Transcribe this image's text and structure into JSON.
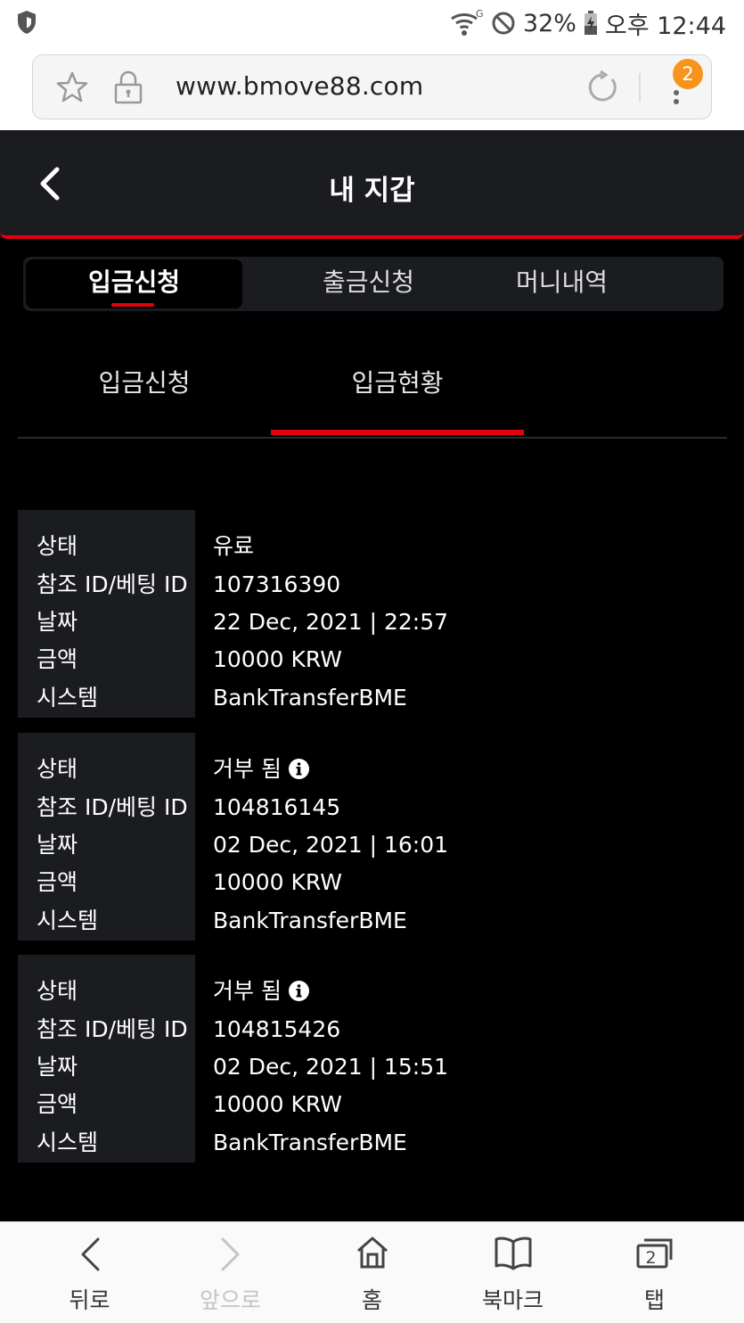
{
  "status_bar": {
    "battery": "32%",
    "time": "오후 12:44",
    "network_badge": "G"
  },
  "browser": {
    "url": "www.bmove88.com",
    "menu_badge": "2"
  },
  "header": {
    "title": "내 지갑"
  },
  "main_tabs": [
    {
      "label": "입금신청",
      "active": true
    },
    {
      "label": "출금신청",
      "active": false
    },
    {
      "label": "머니내역",
      "active": false
    }
  ],
  "sub_tabs": [
    {
      "label": "입금신청",
      "active": false
    },
    {
      "label": "입금현황",
      "active": true
    }
  ],
  "field_labels": {
    "status": "상태",
    "ref_id": "참조 ID/베팅 ID",
    "date": "날짜",
    "amount": "금액",
    "system": "시스템"
  },
  "records": [
    {
      "status": "유료",
      "status_info": false,
      "ref_id": "107316390",
      "date": "22 Dec, 2021 | 22:57",
      "amount": "10000 KRW",
      "system": "BankTransferBME"
    },
    {
      "status": "거부 됨",
      "status_info": true,
      "ref_id": "104816145",
      "date": "02 Dec, 2021 | 16:01",
      "amount": "10000 KRW",
      "system": "BankTransferBME"
    },
    {
      "status": "거부 됨",
      "status_info": true,
      "ref_id": "104815426",
      "date": "02 Dec, 2021 | 15:51",
      "amount": "10000 KRW",
      "system": "BankTransferBME"
    }
  ],
  "bottom_nav": [
    {
      "label": "뒤로",
      "icon": "back-arrow-icon",
      "disabled": false
    },
    {
      "label": "앞으로",
      "icon": "forward-arrow-icon",
      "disabled": true
    },
    {
      "label": "홈",
      "icon": "home-icon",
      "disabled": false
    },
    {
      "label": "북마크",
      "icon": "bookmark-book-icon",
      "disabled": false
    },
    {
      "label": "탭",
      "icon": "tabs-icon",
      "disabled": false,
      "count": "2"
    }
  ],
  "colors": {
    "accent_red": "#e3000f",
    "panel_dark": "#1b1c20",
    "background": "#000000",
    "badge_orange": "#f7941d"
  }
}
